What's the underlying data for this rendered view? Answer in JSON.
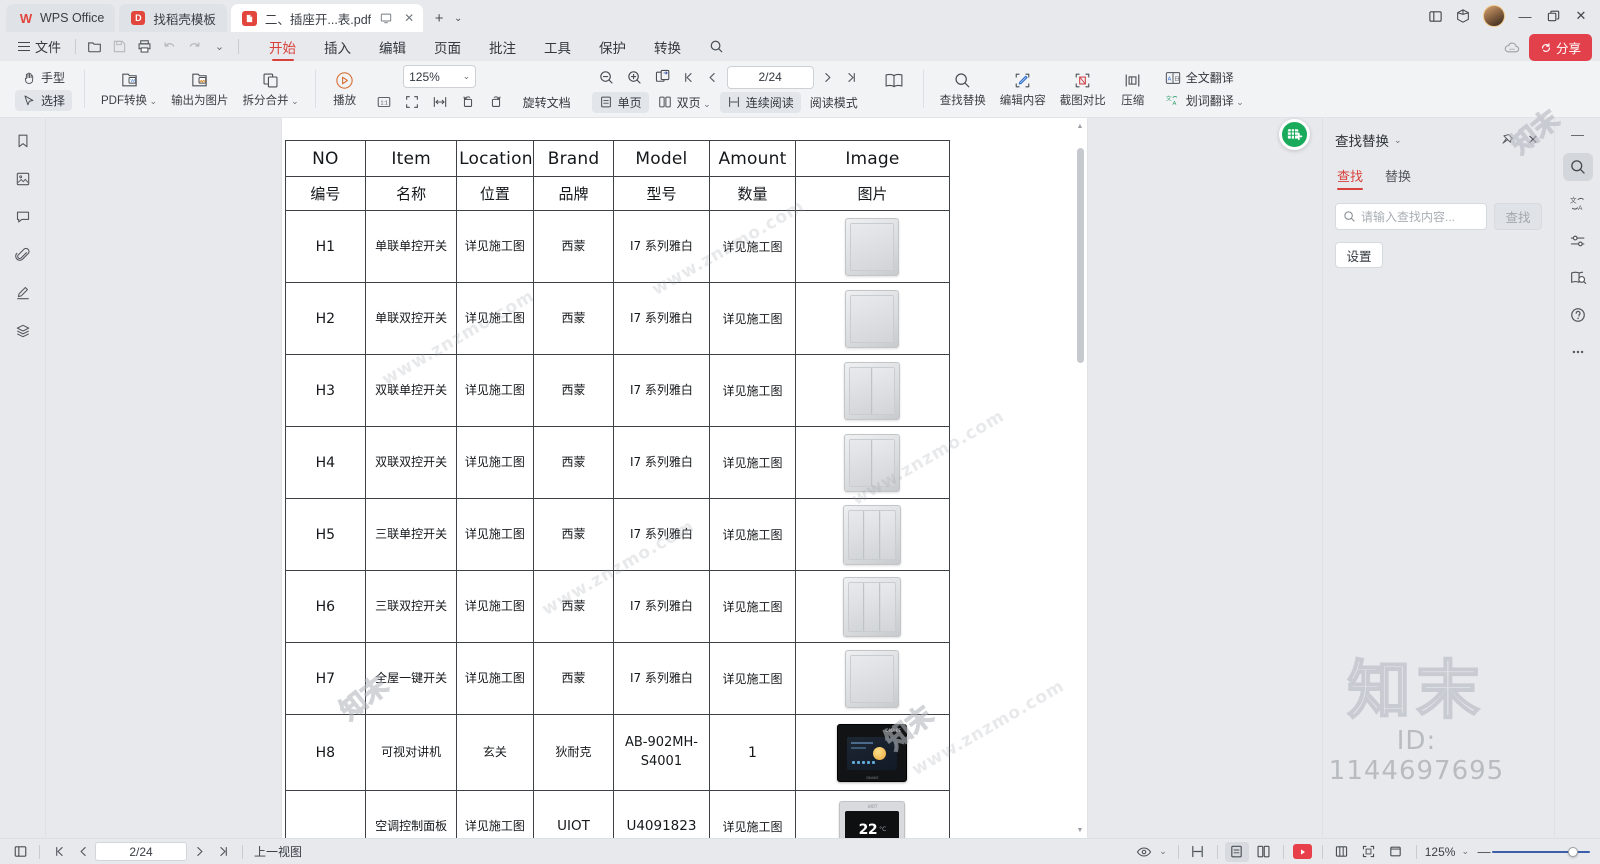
{
  "window": {
    "tabs": [
      {
        "label": "WPS Office",
        "icon": "wps-logo-icon",
        "type": "app"
      },
      {
        "label": "找稻壳模板",
        "icon": "docer-icon",
        "type": "template"
      },
      {
        "label": "二、插座开...表.pdf",
        "icon": "pdf-file-icon",
        "type": "document",
        "active": true
      }
    ],
    "new_tab_label": "+",
    "controls": {
      "minimize": "—",
      "maximize": "▢",
      "close": "✕"
    },
    "share_label": "分享"
  },
  "menubar": {
    "file_label": "文件",
    "quick_access": [
      "new-icon",
      "save-icon",
      "print-icon",
      "undo-icon",
      "redo-icon",
      "customize-chevron-icon"
    ],
    "menus": [
      {
        "label": "开始",
        "active": true
      },
      {
        "label": "插入",
        "active": false
      },
      {
        "label": "编辑",
        "active": false
      },
      {
        "label": "页面",
        "active": false
      },
      {
        "label": "批注",
        "active": false
      },
      {
        "label": "工具",
        "active": false
      },
      {
        "label": "保护",
        "active": false
      },
      {
        "label": "转换",
        "active": false
      }
    ],
    "search_icon": "search-icon"
  },
  "ribbon": {
    "hand_tool": "手型",
    "select_tool": "选择",
    "pdf_convert": "PDF转换",
    "output_image": "输出为图片",
    "split_merge": "拆分合并",
    "play": "播放",
    "zoom_value": "125%",
    "page_indicator": "2/24",
    "rotate_doc": "旋转文档",
    "single_page": "单页",
    "double_page": "双页",
    "continuous_read": "连续阅读",
    "read_mode": "阅读模式",
    "find_replace": "查找替换",
    "edit_content": "编辑内容",
    "screenshot_compare": "截图对比",
    "compress": "压缩",
    "full_translate": "全文翻译",
    "word_translate": "划词翻译"
  },
  "left_rail": {
    "items": [
      {
        "name": "bookmark-icon",
        "label": "书签"
      },
      {
        "name": "thumbnail-icon",
        "label": "缩略图"
      },
      {
        "name": "comment-icon",
        "label": "批注"
      },
      {
        "name": "attachment-icon",
        "label": "附件"
      },
      {
        "name": "signature-icon",
        "label": "签名"
      },
      {
        "name": "layers-icon",
        "label": "图层"
      }
    ]
  },
  "right_rail": {
    "minimize": "—",
    "items": [
      {
        "name": "search-icon",
        "label": "搜索",
        "active": true
      },
      {
        "name": "translate-icon",
        "label": "翻译",
        "active": false
      },
      {
        "name": "settings-sliders-icon",
        "label": "设置",
        "active": false
      },
      {
        "name": "ocr-scan-icon",
        "label": "识别",
        "active": false
      },
      {
        "name": "help-icon",
        "label": "帮助",
        "active": false
      },
      {
        "name": "more-dots-icon",
        "label": "更多",
        "active": false
      }
    ]
  },
  "find_panel": {
    "title": "查找替换",
    "pin_icon": "pin-icon",
    "close_icon": "close-icon",
    "tabs": [
      {
        "label": "查找",
        "active": true
      },
      {
        "label": "替换",
        "active": false
      }
    ],
    "search_placeholder": "请输入查找内容...",
    "search_value": "",
    "search_button": "查找",
    "settings_button": "设置",
    "export_fab": "export-to-excel-icon"
  },
  "statusbar": {
    "view_icon": "page-view-icon",
    "page_indicator": "2/24",
    "prev_view_label": "上一视图",
    "eye_icon": "eye-icon",
    "layout_icons": [
      "continuous-scroll-icon",
      "single-page-icon",
      "two-page-icon",
      "presentation-icon",
      "grid-icon",
      "fit-page-icon",
      "fit-width-icon"
    ],
    "zoom_value": "125%",
    "zoom_minus": "—",
    "zoom_plus": "+"
  },
  "document": {
    "table": {
      "headers_en": [
        "NO",
        "Item",
        "Location",
        "Brand",
        "Model",
        "Amount",
        "Image"
      ],
      "headers_cn": [
        "编号",
        "名称",
        "位置",
        "品牌",
        "型号",
        "数量",
        "图片"
      ],
      "rows": [
        {
          "no": "H1",
          "item": "单联单控开关",
          "location": "详见施工图",
          "brand": "西蒙",
          "model": "I7 系列雅白",
          "amount": "详见施工图",
          "image": "single-gang-one-way-switch"
        },
        {
          "no": "H2",
          "item": "单联双控开关",
          "location": "详见施工图",
          "brand": "西蒙",
          "model": "I7 系列雅白",
          "amount": "详见施工图",
          "image": "single-gang-two-way-switch"
        },
        {
          "no": "H3",
          "item": "双联单控开关",
          "location": "详见施工图",
          "brand": "西蒙",
          "model": "I7 系列雅白",
          "amount": "详见施工图",
          "image": "double-gang-one-way-switch"
        },
        {
          "no": "H4",
          "item": "双联双控开关",
          "location": "详见施工图",
          "brand": "西蒙",
          "model": "I7 系列雅白",
          "amount": "详见施工图",
          "image": "double-gang-two-way-switch"
        },
        {
          "no": "H5",
          "item": "三联单控开关",
          "location": "详见施工图",
          "brand": "西蒙",
          "model": "I7 系列雅白",
          "amount": "详见施工图",
          "image": "triple-gang-one-way-switch"
        },
        {
          "no": "H6",
          "item": "三联双控开关",
          "location": "详见施工图",
          "brand": "西蒙",
          "model": "I7 系列雅白",
          "amount": "详见施工图",
          "image": "triple-gang-two-way-switch"
        },
        {
          "no": "H7",
          "item": "全屋一键开关",
          "location": "详见施工图",
          "brand": "西蒙",
          "model": "I7 系列雅白",
          "amount": "详见施工图",
          "image": "whole-house-master-switch"
        },
        {
          "no": "H8",
          "item": "可视对讲机",
          "location": "玄关",
          "brand": "狄耐克",
          "model": "AB-902MH-S4001",
          "amount": "1",
          "image": "video-intercom"
        },
        {
          "no": "",
          "item": "空调控制面板",
          "location": "详见施工图",
          "brand": "UIOT",
          "model": "U4091823",
          "amount": "详见施工图",
          "image": "ac-control-panel"
        }
      ]
    }
  },
  "watermarks": {
    "site": "www.znzmo.com",
    "brand": "知末",
    "id": "ID: 1144697695"
  },
  "colors": {
    "accent_red": "#d8413a",
    "share_red": "#e2404b",
    "chrome_bg": "#e7e9ed",
    "ribbon_bg": "#f2f3f5",
    "green_fab": "#1aaa5c",
    "slider_blue": "#3d5ea8"
  }
}
